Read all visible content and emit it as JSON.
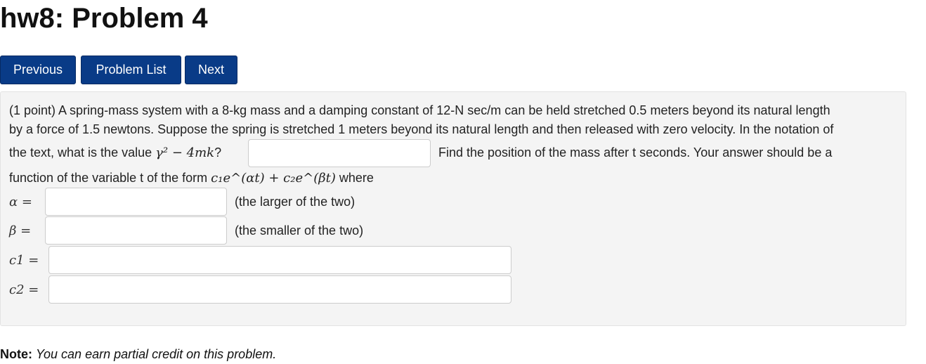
{
  "page": {
    "title": "hw8: Problem 4"
  },
  "nav": {
    "previous_label": "Previous",
    "problem_list_label": "Problem List",
    "next_label": "Next"
  },
  "problem": {
    "line1": "(1 point) A spring-mass system with a 8-kg mass and a damping constant of 12-N sec/m can be held stretched 0.5 meters beyond its natural length",
    "line2": "by a force of 1.5 newtons. Suppose the spring is stretched 1 meters beyond its natural length and then released with zero velocity. In the notation of",
    "line3_before": "the text, what is the value",
    "line3_math": "γ² − 4mk",
    "line3_after": "?",
    "line3_tail": "Find the position of the mass after t seconds. Your answer should be a",
    "line4_before": "function of the variable t of the form",
    "line4_math": "c₁e^(αt) + c₂e^(βt)",
    "line4_after": "where",
    "answers": [
      {
        "label": "α",
        "hint": "(the larger of the two)",
        "value": ""
      },
      {
        "label": "β",
        "hint": "(the smaller of the two)",
        "value": ""
      },
      {
        "label": "c1",
        "hint": "",
        "value": ""
      },
      {
        "label": "c2",
        "hint": "",
        "value": ""
      }
    ],
    "discriminant_value": ""
  },
  "note": {
    "label": "Note:",
    "text": "You can earn partial credit on this problem."
  },
  "colors": {
    "button_bg": "#093b87",
    "problem_bg": "#f4f4f4"
  }
}
